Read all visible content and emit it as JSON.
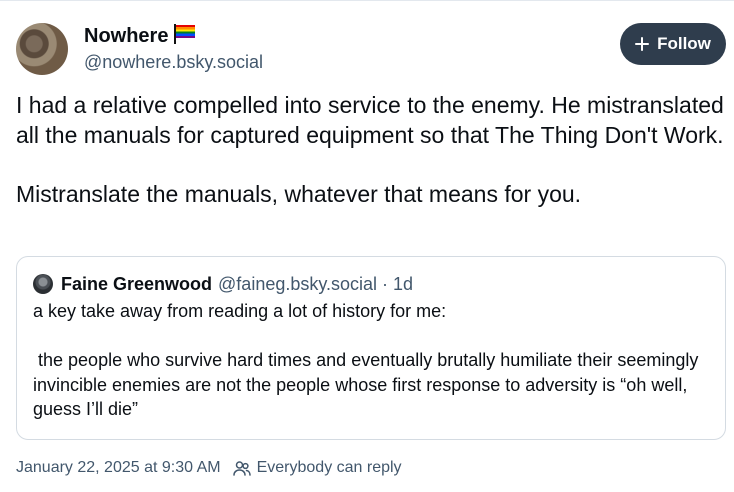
{
  "author": {
    "display_name": "Nowhere",
    "flag_icon": "rainbow-flag-icon",
    "handle": "@nowhere.bsky.social"
  },
  "follow_button": {
    "label": "Follow",
    "icon": "plus-icon",
    "background": "#2f3d4d"
  },
  "post": {
    "paragraph_1": "I had a relative compelled into service to the enemy. He mistranslated all the manuals for captured equipment so that The Thing Don't Work.",
    "paragraph_2": "Mistranslate the manuals, whatever that means for you."
  },
  "quote": {
    "display_name": "Faine Greenwood",
    "handle": "@faineg.bsky.social",
    "separator": "·",
    "time": "1d",
    "paragraph_1": "a key take away from reading a lot of history for me:",
    "paragraph_2": " the people who survive hard times and eventually brutally humiliate their seemingly invincible enemies are not the people whose first response to adversity is “oh well, guess I’ll die”"
  },
  "footer": {
    "timestamp": "January 22, 2025 at 9:30 AM",
    "reply_icon": "people-icon",
    "reply_setting": "Everybody can reply"
  }
}
